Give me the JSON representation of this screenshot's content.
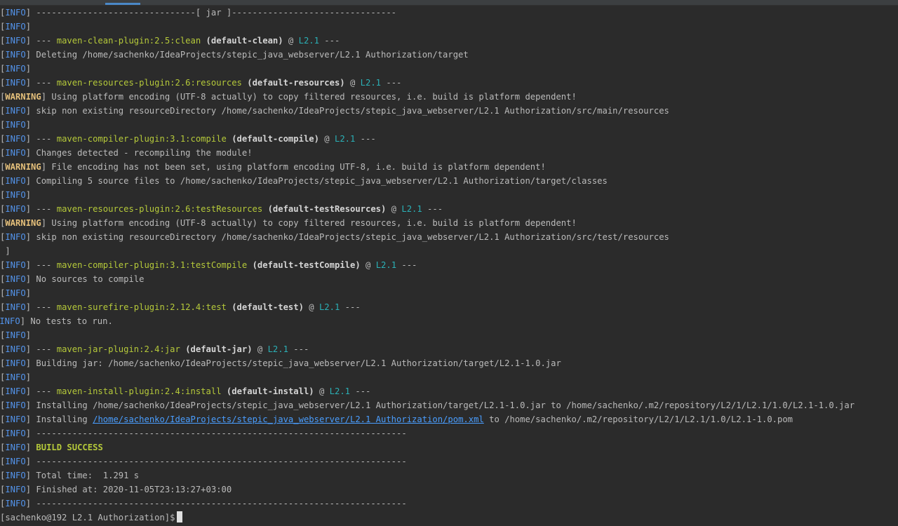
{
  "colors": {
    "background": "#2b2b2b",
    "info": "#5394ec",
    "warning": "#e5c07b",
    "plugin": "#b5c93a",
    "project": "#2bb0b6",
    "link": "#4a9eff"
  },
  "lines": [
    {
      "tag": "INFO",
      "parts": [
        {
          "t": "text",
          "v": " -------------------------------[ jar ]--------------------------------"
        }
      ]
    },
    {
      "tag": "INFO",
      "parts": []
    },
    {
      "tag": "INFO",
      "parts": [
        {
          "t": "text",
          "v": " --- "
        },
        {
          "t": "plugin",
          "v": "maven-clean-plugin:2.5:clean"
        },
        {
          "t": "text",
          "v": " "
        },
        {
          "t": "exec",
          "v": "(default-clean)"
        },
        {
          "t": "text",
          "v": " @ "
        },
        {
          "t": "project",
          "v": "L2.1"
        },
        {
          "t": "text",
          "v": " ---"
        }
      ]
    },
    {
      "tag": "INFO",
      "parts": [
        {
          "t": "text",
          "v": " Deleting /home/sachenko/IdeaProjects/stepic_java_webserver/L2.1 Authorization/target"
        }
      ]
    },
    {
      "tag": "INFO",
      "parts": []
    },
    {
      "tag": "INFO",
      "parts": [
        {
          "t": "text",
          "v": " --- "
        },
        {
          "t": "plugin",
          "v": "maven-resources-plugin:2.6:resources"
        },
        {
          "t": "text",
          "v": " "
        },
        {
          "t": "exec",
          "v": "(default-resources)"
        },
        {
          "t": "text",
          "v": " @ "
        },
        {
          "t": "project",
          "v": "L2.1"
        },
        {
          "t": "text",
          "v": " ---"
        }
      ]
    },
    {
      "tag": "WARNING",
      "parts": [
        {
          "t": "text",
          "v": " Using platform encoding (UTF-8 actually) to copy filtered resources, i.e. build is platform dependent!"
        }
      ]
    },
    {
      "tag": "INFO",
      "parts": [
        {
          "t": "text",
          "v": " skip non existing resourceDirectory /home/sachenko/IdeaProjects/stepic_java_webserver/L2.1 Authorization/src/main/resources"
        }
      ]
    },
    {
      "tag": "INFO",
      "parts": []
    },
    {
      "tag": "INFO",
      "parts": [
        {
          "t": "text",
          "v": " --- "
        },
        {
          "t": "plugin",
          "v": "maven-compiler-plugin:3.1:compile"
        },
        {
          "t": "text",
          "v": " "
        },
        {
          "t": "exec",
          "v": "(default-compile)"
        },
        {
          "t": "text",
          "v": " @ "
        },
        {
          "t": "project",
          "v": "L2.1"
        },
        {
          "t": "text",
          "v": " ---"
        }
      ]
    },
    {
      "tag": "INFO",
      "parts": [
        {
          "t": "text",
          "v": " Changes detected - recompiling the module!"
        }
      ]
    },
    {
      "tag": "WARNING",
      "parts": [
        {
          "t": "text",
          "v": " File encoding has not been set, using platform encoding UTF-8, i.e. build is platform dependent!"
        }
      ]
    },
    {
      "tag": "INFO",
      "parts": [
        {
          "t": "text",
          "v": " Compiling 5 source files to /home/sachenko/IdeaProjects/stepic_java_webserver/L2.1 Authorization/target/classes"
        }
      ]
    },
    {
      "tag": "INFO",
      "parts": []
    },
    {
      "tag": "INFO",
      "parts": [
        {
          "t": "text",
          "v": " --- "
        },
        {
          "t": "plugin",
          "v": "maven-resources-plugin:2.6:testResources"
        },
        {
          "t": "text",
          "v": " "
        },
        {
          "t": "exec",
          "v": "(default-testResources)"
        },
        {
          "t": "text",
          "v": " @ "
        },
        {
          "t": "project",
          "v": "L2.1"
        },
        {
          "t": "text",
          "v": " ---"
        }
      ]
    },
    {
      "tag": "WARNING",
      "parts": [
        {
          "t": "text",
          "v": " Using platform encoding (UTF-8 actually) to copy filtered resources, i.e. build is platform dependent!"
        }
      ]
    },
    {
      "tag": "INFO",
      "parts": [
        {
          "t": "text",
          "v": " skip non existing resourceDirectory /home/sachenko/IdeaProjects/stepic_java_webserver/L2.1 Authorization/src/test/resources"
        }
      ]
    },
    {
      "tag": "",
      "parts": [
        {
          "t": "text",
          "v": " ]"
        }
      ]
    },
    {
      "tag": "INFO",
      "parts": [
        {
          "t": "text",
          "v": " --- "
        },
        {
          "t": "plugin",
          "v": "maven-compiler-plugin:3.1:testCompile"
        },
        {
          "t": "text",
          "v": " "
        },
        {
          "t": "exec",
          "v": "(default-testCompile)"
        },
        {
          "t": "text",
          "v": " @ "
        },
        {
          "t": "project",
          "v": "L2.1"
        },
        {
          "t": "text",
          "v": " ---"
        }
      ]
    },
    {
      "tag": "INFO",
      "parts": [
        {
          "t": "text",
          "v": " No sources to compile"
        }
      ]
    },
    {
      "tag": "INFO",
      "parts": []
    },
    {
      "tag": "INFO",
      "parts": [
        {
          "t": "text",
          "v": " --- "
        },
        {
          "t": "plugin",
          "v": "maven-surefire-plugin:2.12.4:test"
        },
        {
          "t": "text",
          "v": " "
        },
        {
          "t": "exec",
          "v": "(default-test)"
        },
        {
          "t": "text",
          "v": " @ "
        },
        {
          "t": "project",
          "v": "L2.1"
        },
        {
          "t": "text",
          "v": " ---"
        }
      ]
    },
    {
      "tag": "INFO",
      "offset": true,
      "parts": [
        {
          "t": "text",
          "v": " No tests to run."
        }
      ]
    },
    {
      "tag": "INFO",
      "parts": []
    },
    {
      "tag": "INFO",
      "parts": [
        {
          "t": "text",
          "v": " --- "
        },
        {
          "t": "plugin",
          "v": "maven-jar-plugin:2.4:jar"
        },
        {
          "t": "text",
          "v": " "
        },
        {
          "t": "exec",
          "v": "(default-jar)"
        },
        {
          "t": "text",
          "v": " @ "
        },
        {
          "t": "project",
          "v": "L2.1"
        },
        {
          "t": "text",
          "v": " ---"
        }
      ]
    },
    {
      "tag": "INFO",
      "parts": [
        {
          "t": "text",
          "v": " Building jar: /home/sachenko/IdeaProjects/stepic_java_webserver/L2.1 Authorization/target/L2.1-1.0.jar"
        }
      ]
    },
    {
      "tag": "INFO",
      "parts": []
    },
    {
      "tag": "INFO",
      "parts": [
        {
          "t": "text",
          "v": " --- "
        },
        {
          "t": "plugin",
          "v": "maven-install-plugin:2.4:install"
        },
        {
          "t": "text",
          "v": " "
        },
        {
          "t": "exec",
          "v": "(default-install)"
        },
        {
          "t": "text",
          "v": " @ "
        },
        {
          "t": "project",
          "v": "L2.1"
        },
        {
          "t": "text",
          "v": " ---"
        }
      ]
    },
    {
      "tag": "INFO",
      "parts": [
        {
          "t": "text",
          "v": " Installing /home/sachenko/IdeaProjects/stepic_java_webserver/L2.1 Authorization/target/L2.1-1.0.jar to /home/sachenko/.m2/repository/L2/1/L2.1/1.0/L2.1-1.0.jar"
        }
      ]
    },
    {
      "tag": "INFO",
      "parts": [
        {
          "t": "text",
          "v": " Installing "
        },
        {
          "t": "link",
          "v": "/home/sachenko/IdeaProjects/stepic_java_webserver/L2.1 Authorization/pom.xml"
        },
        {
          "t": "text",
          "v": " to /home/sachenko/.m2/repository/L2/1/L2.1/1.0/L2.1-1.0.pom"
        }
      ]
    },
    {
      "tag": "INFO",
      "parts": [
        {
          "t": "text",
          "v": " ------------------------------------------------------------------------"
        }
      ]
    },
    {
      "tag": "INFO",
      "parts": [
        {
          "t": "text",
          "v": " "
        },
        {
          "t": "success",
          "v": "BUILD SUCCESS"
        }
      ]
    },
    {
      "tag": "INFO",
      "parts": [
        {
          "t": "text",
          "v": " ------------------------------------------------------------------------"
        }
      ]
    },
    {
      "tag": "INFO",
      "parts": [
        {
          "t": "text",
          "v": " Total time:  1.291 s"
        }
      ]
    },
    {
      "tag": "INFO",
      "parts": [
        {
          "t": "text",
          "v": " Finished at: 2020-11-05T23:13:27+03:00"
        }
      ]
    },
    {
      "tag": "INFO",
      "parts": [
        {
          "t": "text",
          "v": " ------------------------------------------------------------------------"
        }
      ]
    }
  ],
  "prompt": {
    "text": "[sachenko@192 L2.1 Authorization]$"
  }
}
